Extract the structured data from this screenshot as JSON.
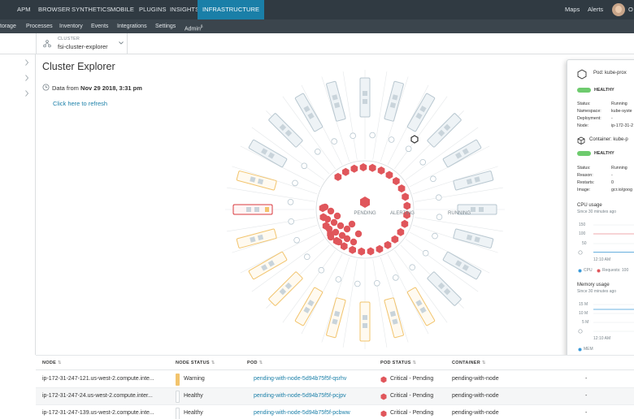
{
  "topnav": {
    "tabs": [
      "APM",
      "BROWSER",
      "SYNTHETICS",
      "MOBILE",
      "PLUGINS",
      "INSIGHTS",
      "INFRASTRUCTURE"
    ],
    "right": [
      "Maps",
      "Alerts"
    ],
    "user_initial": "O"
  },
  "subnav": {
    "items": [
      "torage",
      "Processes",
      "Inventory",
      "Events",
      "Integrations",
      "Settings",
      "Admin"
    ],
    "admin_sup": "β"
  },
  "breadcrumb": {
    "kicker": "CLUSTER",
    "value": "fsi-cluster-explorer"
  },
  "main": {
    "title": "Cluster Explorer",
    "data_from_label": "Data from",
    "data_from_value": "Nov 29 2018, 3:31 pm",
    "refresh_link": "Click here to refresh"
  },
  "viz": {
    "labels": {
      "pending": "PENDING",
      "alerting": "ALERTING",
      "running": "RUNNING"
    },
    "center_icon": "kubernetes-icon",
    "colors": {
      "critical": "#e0565b",
      "warning": "#f2c46d",
      "healthy": "#b8c7d0",
      "selected": "#d93a3f"
    }
  },
  "panel": {
    "pod_label": "Pod:",
    "pod_name": "kube-prox",
    "pod_health": "HEALTHY",
    "pod_fields": [
      {
        "k": "Status:",
        "v": "Running"
      },
      {
        "k": "Namespace:",
        "v": "kube-syste"
      },
      {
        "k": "Deployment:",
        "v": "-"
      },
      {
        "k": "Node:",
        "v": "ip-172-31-2"
      }
    ],
    "container_label": "Container:",
    "container_name": "kube-p",
    "container_health": "HEALTHY",
    "container_fields": [
      {
        "k": "Status:",
        "v": "Running"
      },
      {
        "k": "Reason:",
        "v": "-"
      },
      {
        "k": "Restarts:",
        "v": "0"
      },
      {
        "k": "Image:",
        "v": "gcr.io/goog"
      }
    ],
    "cpu": {
      "title": "CPU usage",
      "subtitle": "Since 30 minutes ago",
      "ticks": [
        "150",
        "100",
        "50",
        "0"
      ],
      "time_tick": "12:10 AM",
      "legend": [
        "CPU",
        "Requests: 100"
      ]
    },
    "mem": {
      "title": "Memory usage",
      "subtitle": "Since 30 minutes ago",
      "ticks": [
        "15 M",
        "10 M",
        "5 M",
        "0"
      ],
      "time_tick": "12:10 AM",
      "legend": [
        "MEM"
      ]
    }
  },
  "table": {
    "headers": [
      "NODE",
      "NODE STATUS",
      "POD",
      "POD STATUS",
      "CONTAINER"
    ],
    "rows": [
      {
        "node": "ip-172-31-247-121.us-west-2.compute.inte...",
        "node_status": "Warning",
        "pod": "pending-with-node-5d94b75f5f-qsrhv",
        "pod_status": "Critical - Pending",
        "container": "pending-with-node",
        "extra": "-"
      },
      {
        "node": "ip-172-31-247-24.us-west-2.compute.inter...",
        "node_status": "Healthy",
        "pod": "pending-with-node-5d94b75f5f-pcjpv",
        "pod_status": "Critical - Pending",
        "container": "pending-with-node",
        "extra": "-"
      },
      {
        "node": "ip-172-31-247-139.us-west-2.compute.inte...",
        "node_status": "Healthy",
        "pod": "pending-with-node-5d94b75f5f-pcbww",
        "pod_status": "Critical - Pending",
        "container": "pending-with-node",
        "extra": "-"
      }
    ]
  }
}
